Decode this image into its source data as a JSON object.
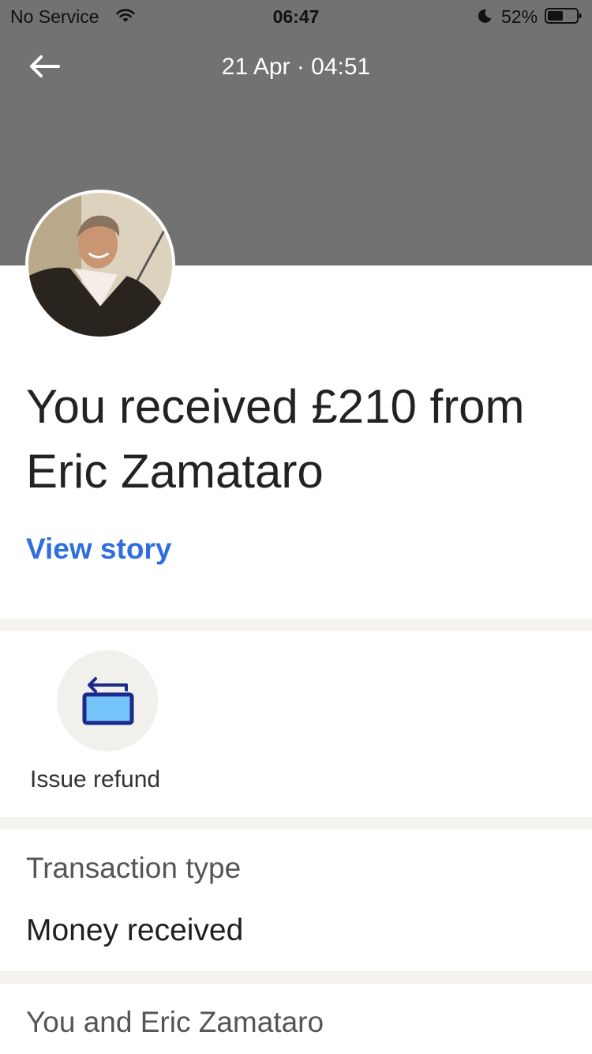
{
  "status_bar": {
    "carrier": "No Service",
    "time": "06:47",
    "battery": "52%"
  },
  "header": {
    "date_time": "21 Apr · 04:51",
    "background_color": "#727272"
  },
  "transaction": {
    "headline": "You received £210 from Eric Zamataro",
    "view_story": "View story"
  },
  "actions": {
    "issue_refund": "Issue refund"
  },
  "details": {
    "type_label": "Transaction type",
    "type_value": "Money received"
  },
  "relationship": {
    "title": "You and Eric Zamataro"
  },
  "colors": {
    "link": "#2f6ee0",
    "refund_icon_fill": "#74c4f9",
    "refund_icon_stroke": "#1c2a8c"
  },
  "icons": [
    "wifi-icon",
    "moon-icon",
    "battery-icon",
    "back-arrow-icon",
    "refund-icon"
  ]
}
